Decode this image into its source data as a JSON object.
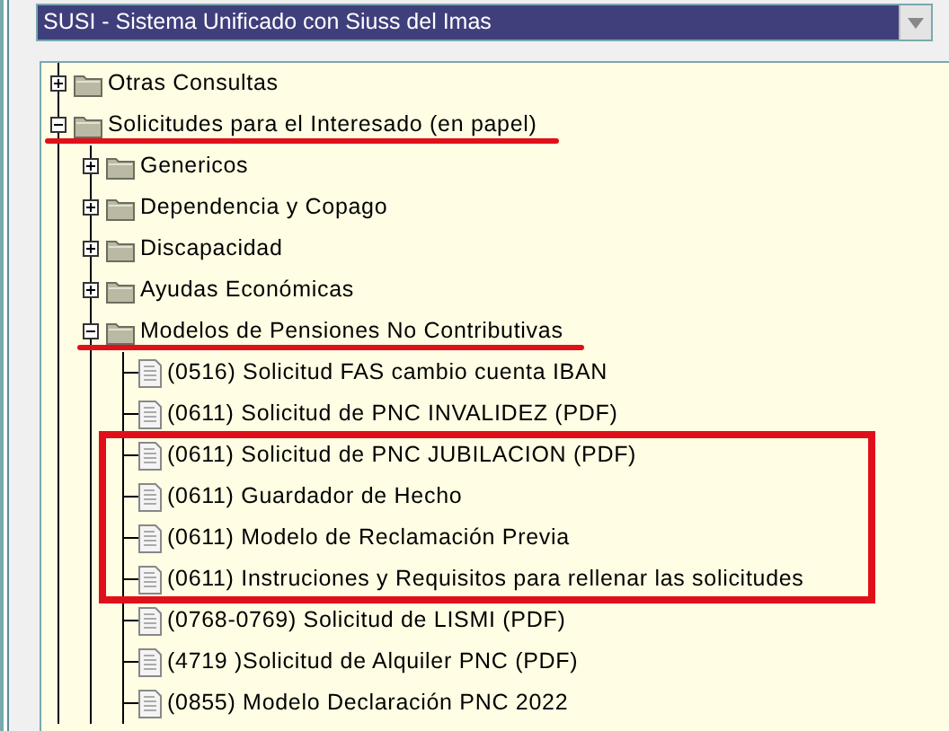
{
  "system_select": {
    "value": "SUSI - Sistema Unificado con Siuss del Imas"
  },
  "tree": [
    {
      "label": "Otras Consultas",
      "kind": "folder",
      "expanded": false,
      "underlined": false
    },
    {
      "label": "Solicitudes para el Interesado (en papel)",
      "kind": "folder",
      "expanded": true,
      "underlined": true,
      "children": [
        {
          "label": "Genericos",
          "kind": "folder",
          "expanded": false,
          "underlined": false
        },
        {
          "label": "Dependencia y Copago",
          "kind": "folder",
          "expanded": false,
          "underlined": false
        },
        {
          "label": "Discapacidad",
          "kind": "folder",
          "expanded": false,
          "underlined": false
        },
        {
          "label": "Ayudas Económicas",
          "kind": "folder",
          "expanded": false,
          "underlined": false
        },
        {
          "label": "Modelos de Pensiones No Contributivas",
          "kind": "folder",
          "expanded": true,
          "underlined": true,
          "children": [
            {
              "label": "(0516) Solicitud FAS cambio cuenta IBAN",
              "kind": "document",
              "boxed": false
            },
            {
              "label": "(0611) Solicitud de PNC INVALIDEZ (PDF)",
              "kind": "document",
              "boxed": false
            },
            {
              "label": "(0611) Solicitud de PNC JUBILACION (PDF)",
              "kind": "document",
              "boxed": true
            },
            {
              "label": "(0611) Guardador de Hecho",
              "kind": "document",
              "boxed": true
            },
            {
              "label": "(0611) Modelo de Reclamación Previa",
              "kind": "document",
              "boxed": true
            },
            {
              "label": "(0611) Instruciones y Requisitos para rellenar las solicitudes",
              "kind": "document",
              "boxed": true
            },
            {
              "label": "(0768-0769) Solicitud de LISMI (PDF)",
              "kind": "document",
              "boxed": false
            },
            {
              "label": "(4719 )Solicitud de Alquiler PNC (PDF)",
              "kind": "document",
              "boxed": false
            },
            {
              "label": "(0855) Modelo Declaración PNC 2022",
              "kind": "document",
              "boxed": false
            }
          ]
        }
      ]
    }
  ]
}
